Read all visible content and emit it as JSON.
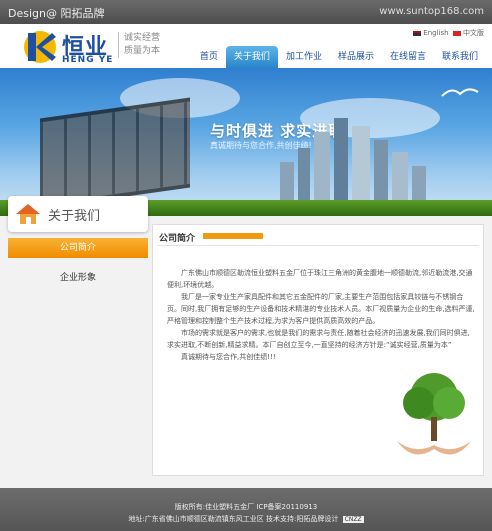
{
  "topbar": {
    "designer": "Design@ 阳拓品牌",
    "site_url": "www.suntop168.com"
  },
  "header": {
    "brand_cn": "恒业",
    "brand_en": "HENG YE",
    "slogan_line1": "诚实经营",
    "slogan_line2": "质量为本",
    "lang_en": "English",
    "lang_cn": "中文版"
  },
  "nav": {
    "items": [
      {
        "label": "首页"
      },
      {
        "label": "关于我们"
      },
      {
        "label": "加工作业"
      },
      {
        "label": "样品展示"
      },
      {
        "label": "在线留言"
      },
      {
        "label": "联系我们"
      }
    ],
    "active_index": 1
  },
  "banner": {
    "headline": "与时俱进  求实进取",
    "subline": "真诚期待与您合作,共创佳绩!"
  },
  "sidebar": {
    "title": "关于我们",
    "items": [
      {
        "label": "公司简介"
      },
      {
        "label": "企业形象"
      }
    ],
    "active_index": 0
  },
  "content": {
    "title": "公司简介",
    "paragraphs": [
      "广东佛山市顺德区勒流恒业塑料五金厂位于珠江三角洲的黄金腹地一顺德勒流,邻近勒流港,交通便利,环境优越。",
      "我厂是一家专业生产家具配件和其它五金配件的厂家,主要生产范围包括家具铰链与不锈钢合页。同时,我厂拥有足够的生产设备和技术精湛的专业技术人员。本厂视质量为企业的生命,选料严谨,严格管理和控制整个生产技术过程,为求为客户提供高质高效的产品。",
      "市场的需求就是客户的需求,也就是我们的需求与责任,随着社会经济的迅速发展,我们同时俱进,求实进取,不断创新,精益求精。本厂自创立至今,一直坚持的经济方针是:“诚实经营,质量为本”",
      "真诚期待与您合作,共创佳绩!!!"
    ]
  },
  "footer": {
    "line1": "版权所有:佳业塑料五金厂  ICP备案20110913",
    "line2": "地址:广东省佛山市顺德区勒流镇东风工业区   技术支持:阳拓品牌设计",
    "badge": "CNZZ"
  },
  "colors": {
    "accent_orange": "#f29a0e",
    "brand_blue": "#1f4fa0",
    "nav_active": "#2a86c9"
  }
}
